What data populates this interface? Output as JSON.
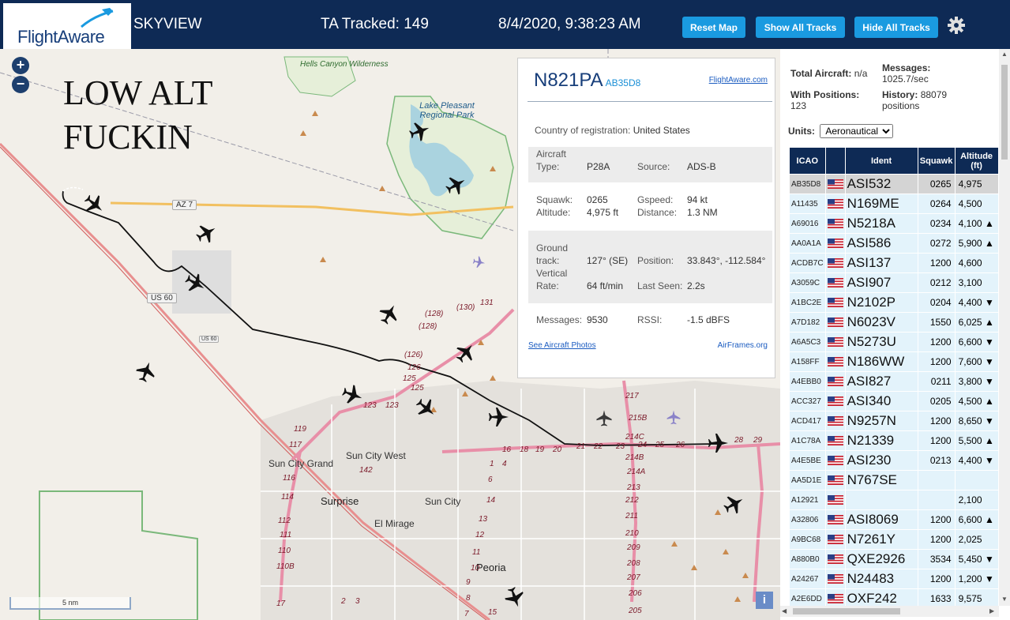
{
  "header": {
    "logo": "FlightAware",
    "app_name": "SKYVIEW",
    "tracked": "TA Tracked: 149",
    "datetime": "8/4/2020, 9:38:23 AM",
    "buttons": {
      "reset": "Reset Map",
      "show_all": "Show All Tracks",
      "hide_all": "Hide All Tracks"
    },
    "settings_icon": "gear-icon"
  },
  "map": {
    "overlay_text_line1": "LOW ALT",
    "overlay_text_line2": "FUCKIN",
    "zoom_in": "+",
    "zoom_out": "−",
    "scale": "5 nm",
    "info": "i",
    "labels": {
      "hells_canyon": "Hells Canyon Wilderness",
      "lake_pleasant": "Lake Pleasant Regional Park",
      "sun_city_grand": "Sun City Grand",
      "sun_city_west": "Sun City West",
      "surprise": "Surprise",
      "sun_city": "Sun City",
      "el_mirage": "El Mirage",
      "peoria": "Peoria"
    },
    "shields": {
      "az74": "AZ 7",
      "us60": "US 60",
      "us60_small": "US 60"
    },
    "road_numbers": [
      "131",
      "(130)",
      "(128)",
      "(128)",
      "(126)",
      "126",
      "125",
      "125",
      "123",
      "123",
      "142",
      "119",
      "117",
      "116",
      "114",
      "112",
      "111",
      "110",
      "110B",
      "17",
      "16",
      "18",
      "19",
      "20",
      "21",
      "22",
      "23",
      "24",
      "25",
      "26",
      "28",
      "29",
      "217",
      "215B",
      "214C",
      "214B",
      "214A",
      "213",
      "212",
      "211",
      "210",
      "209",
      "208",
      "207",
      "206",
      "205",
      "14",
      "13",
      "12",
      "11",
      "10",
      "9",
      "8",
      "7",
      "6",
      "4",
      "3",
      "2",
      "15",
      "1"
    ]
  },
  "popup": {
    "ident": "N821PA",
    "icao": "AB35D8",
    "link": "FlightAware.com",
    "country_label": "Country of registration:",
    "country": "United States",
    "aircraft_type_label_1": "Aircraft",
    "aircraft_type_label_2": "Type:",
    "aircraft_type": "P28A",
    "source_label": "Source:",
    "source": "ADS-B",
    "squawk_label": "Squawk:",
    "squawk": "0265",
    "gspeed_label": "Gspeed:",
    "gspeed": "94 kt",
    "altitude_label": "Altitude:",
    "altitude": "4,975 ft",
    "distance_label": "Distance:",
    "distance": "1.3 NM",
    "ground_label_1": "Ground",
    "ground_label_2": "track:",
    "ground_track": "127° (SE)",
    "position_label": "Position:",
    "position": "33.843°, -112.584°",
    "vert_label_1": "Vertical",
    "vert_label_2": "Rate:",
    "vert_rate": "64 ft/min",
    "last_seen_label": "Last Seen:",
    "last_seen": "2.2s",
    "messages_label": "Messages:",
    "messages": "9530",
    "rssi_label": "RSSI:",
    "rssi": "-1.5 dBFS",
    "photos_link": "See Aircraft Photos",
    "airframes_link": "AirFrames.org"
  },
  "panel": {
    "total_label": "Total Aircraft:",
    "total": "n/a",
    "messages_label": "Messages:",
    "messages": "1025.7/sec",
    "positions_label": "With Positions:",
    "positions": "123",
    "history_label": "History:",
    "history": "88079",
    "history_unit": "positions",
    "units_label": "Units:",
    "units_value": "Aeronautical",
    "columns": [
      "ICAO",
      "",
      "Ident",
      "Squawk",
      "Altitude (ft)"
    ],
    "rows": [
      {
        "icao": "AB35D8",
        "ident": "ASI532",
        "squawk": "0265",
        "alt": "4,975",
        "trend": "",
        "selected": true
      },
      {
        "icao": "A11435",
        "ident": "N169ME",
        "squawk": "0264",
        "alt": "4,500",
        "trend": ""
      },
      {
        "icao": "A69016",
        "ident": "N5218A",
        "squawk": "0234",
        "alt": "4,100",
        "trend": "▲"
      },
      {
        "icao": "AA0A1A",
        "ident": "ASI586",
        "squawk": "0272",
        "alt": "5,900",
        "trend": "▲"
      },
      {
        "icao": "ACDB7C",
        "ident": "ASI137",
        "squawk": "1200",
        "alt": "4,600",
        "trend": ""
      },
      {
        "icao": "A3059C",
        "ident": "ASI907",
        "squawk": "0212",
        "alt": "3,100",
        "trend": ""
      },
      {
        "icao": "A1BC2E",
        "ident": "N2102P",
        "squawk": "0204",
        "alt": "4,400",
        "trend": "▼"
      },
      {
        "icao": "A7D182",
        "ident": "N6023V",
        "squawk": "1550",
        "alt": "6,025",
        "trend": "▲"
      },
      {
        "icao": "A6A5C3",
        "ident": "N5273U",
        "squawk": "1200",
        "alt": "6,600",
        "trend": "▼"
      },
      {
        "icao": "A158FF",
        "ident": "N186WW",
        "squawk": "1200",
        "alt": "7,600",
        "trend": "▼"
      },
      {
        "icao": "A4EBB0",
        "ident": "ASI827",
        "squawk": "0211",
        "alt": "3,800",
        "trend": "▼"
      },
      {
        "icao": "ACC327",
        "ident": "ASI340",
        "squawk": "0205",
        "alt": "4,500",
        "trend": "▲"
      },
      {
        "icao": "ACD417",
        "ident": "N9257N",
        "squawk": "1200",
        "alt": "8,650",
        "trend": "▼"
      },
      {
        "icao": "A1C78A",
        "ident": "N21339",
        "squawk": "1200",
        "alt": "5,500",
        "trend": "▲"
      },
      {
        "icao": "A4E5BE",
        "ident": "ASI230",
        "squawk": "0213",
        "alt": "4,400",
        "trend": "▼"
      },
      {
        "icao": "AA5D1E",
        "ident": "N767SE",
        "squawk": "",
        "alt": "",
        "trend": ""
      },
      {
        "icao": "A12921",
        "ident": "",
        "squawk": "",
        "alt": "2,100",
        "trend": ""
      },
      {
        "icao": "A32806",
        "ident": "ASI8069",
        "squawk": "1200",
        "alt": "6,600",
        "trend": "▲"
      },
      {
        "icao": "A9BC68",
        "ident": "N7261Y",
        "squawk": "1200",
        "alt": "2,025",
        "trend": ""
      },
      {
        "icao": "A880B0",
        "ident": "QXE2926",
        "squawk": "3534",
        "alt": "5,450",
        "trend": "▼"
      },
      {
        "icao": "A24267",
        "ident": "N24483",
        "squawk": "1200",
        "alt": "1,200",
        "trend": "▼"
      },
      {
        "icao": "A2E6DD",
        "ident": "OXF242",
        "squawk": "1633",
        "alt": "9,575",
        "trend": ""
      }
    ]
  },
  "colors": {
    "header_bg": "#0e2a55",
    "button_bg": "#1a9ae0",
    "row_bg": "#e3f3fb",
    "row_selected_bg": "#d4d4d4",
    "track_line": "#111111",
    "water": "#aad3df",
    "park_border": "#7ab87a"
  }
}
